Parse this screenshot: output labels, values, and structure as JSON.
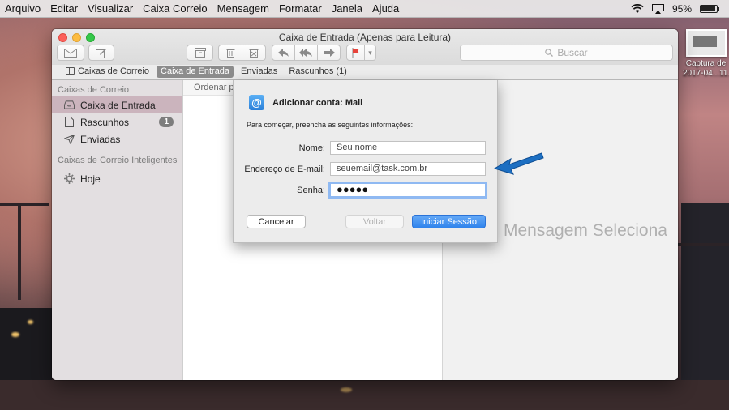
{
  "menubar": {
    "items": [
      "Arquivo",
      "Editar",
      "Visualizar",
      "Caixa Correio",
      "Mensagem",
      "Formatar",
      "Janela",
      "Ajuda"
    ],
    "battery_text": "95%",
    "battery_level": 0.95
  },
  "desktop": {
    "file_label_line1": "Captura de",
    "file_label_line2": "2017-04...11."
  },
  "window": {
    "title": "Caixa de Entrada (Apenas para Leitura)",
    "search_placeholder": "Buscar"
  },
  "favorites_bar": {
    "mailboxes": "Caixas de Correio",
    "inbox": "Caixa de Entrada",
    "sent": "Enviadas",
    "drafts": "Rascunhos (1)"
  },
  "sidebar": {
    "section1": "Caixas de Correio",
    "items": [
      {
        "label": "Caixa de Entrada",
        "icon": "inbox-icon"
      },
      {
        "label": "Rascunhos",
        "icon": "document-icon",
        "badge": "1"
      },
      {
        "label": "Enviadas",
        "icon": "paper-plane-icon"
      }
    ],
    "section2": "Caixas de Correio Inteligentes",
    "smart_items": [
      {
        "label": "Hoje",
        "icon": "gear-icon"
      }
    ]
  },
  "message_list": {
    "sort_label": "Ordenar po"
  },
  "viewer": {
    "empty_text": "Mensagem Seleciona"
  },
  "dialog": {
    "title": "Adicionar conta: Mail",
    "description": "Para começar, preencha as seguintes informações:",
    "name_label": "Nome:",
    "name_value": "Seu nome",
    "email_label": "Endereço de E-mail:",
    "email_value": "seuemail@task.com.br",
    "password_label": "Senha:",
    "password_value": "●●●●●",
    "cancel_button": "Cancelar",
    "back_button": "Voltar",
    "login_button": "Iniciar Sessão"
  },
  "colors": {
    "accent": "#2f83ec",
    "sidebar_selection": "#cbb4bd",
    "annotation_arrow": "#1d6fc2"
  }
}
